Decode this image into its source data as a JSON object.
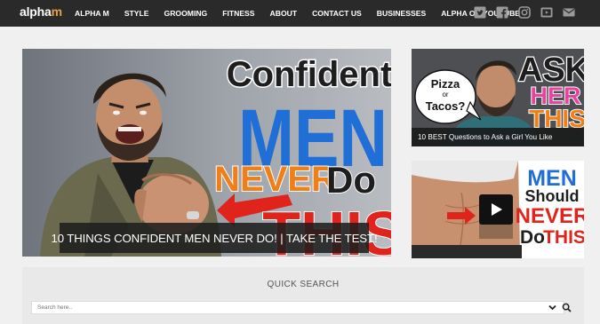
{
  "header": {
    "logo_main": "alpha",
    "logo_accent": "m",
    "nav": [
      "ALPHA M",
      "STYLE",
      "GROOMING",
      "FITNESS",
      "ABOUT",
      "CONTACT US",
      "BUSINESSES",
      "ALPHA ON YOUTUBE"
    ],
    "social_icons": [
      "twitter-icon",
      "facebook-icon",
      "instagram-icon",
      "youtube-icon",
      "email-icon"
    ]
  },
  "hero": {
    "headline": [
      "Confident",
      "MEN",
      "NEVER",
      "Do",
      "THIS"
    ],
    "caption": "10 THINGS CONFIDENT MEN NEVER DO! | TAKE THE TEST!"
  },
  "card1": {
    "bubble_line1": "Pizza",
    "bubble_line2": "or",
    "bubble_line3": "Tacos?",
    "words": [
      "ASK",
      "HER",
      "THIS"
    ],
    "caption": "10 BEST Questions to Ask a Girl You Like"
  },
  "card2": {
    "words": [
      "MEN",
      "Should",
      "NEVER",
      "Do",
      "THIS"
    ],
    "icon": "play-icon"
  },
  "quick_search": {
    "title": "QUICK SEARCH",
    "placeholder": "Search here..",
    "icons": [
      "chevron-down-icon",
      "search-icon"
    ]
  },
  "colors": {
    "topbar": "#2a2a2a",
    "logo_accent": "#e8a23a",
    "headline_blue": "#1f6fd6",
    "headline_orange": "#f07f1a",
    "headline_red": "#e0241b",
    "panel": "#e9e9e9"
  }
}
